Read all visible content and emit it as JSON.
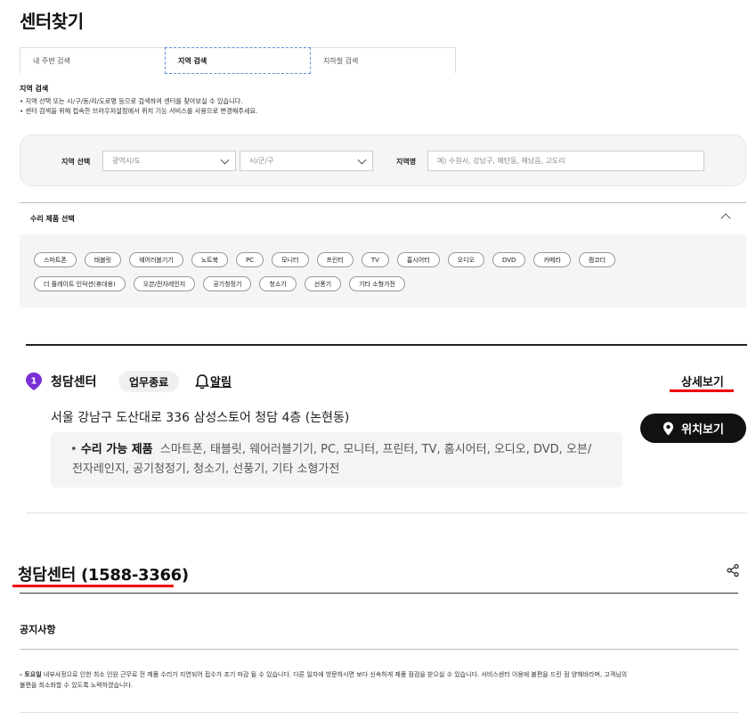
{
  "page": {
    "title": "센터찾기"
  },
  "tabs": [
    {
      "label": "내 주변 검색",
      "active": false
    },
    {
      "label": "지역 검색",
      "active": true
    },
    {
      "label": "지하철 검색",
      "active": false
    }
  ],
  "region_search": {
    "heading": "지역 검색",
    "notes": [
      "• 지역 선택 또는 시/구/동/리/도로명 등으로 검색하여 센터를 찾아보실 수 있습니다.",
      "• 센터 검색을 위해 접속한 브라우저설정에서 위치 기능 서비스를 사용으로 변경해주세요."
    ],
    "region_select_label": "지역 선택",
    "province_placeholder": "광역시/도",
    "city_placeholder": "시/군/구",
    "region_name_label": "지역명",
    "region_name_placeholder": "예) 수원시, 강남구, 매탄동, 해남읍, 고도리"
  },
  "repair": {
    "title": "수리 제품 선택",
    "chips_row1": [
      "스마트폰",
      "태블릿",
      "웨어러블기기",
      "노트북",
      "PC",
      "모니터",
      "프린터",
      "TV",
      "홈시어터",
      "오디오",
      "DVD",
      "카메라",
      "캠코더"
    ],
    "chips_row2": [
      "더 플레이트 인덕션(휴대용)",
      "오븐/전자레인지",
      "공기청정기",
      "청소기",
      "선풍기",
      "기타 소형가전"
    ]
  },
  "result": {
    "index": "1",
    "name": "청담센터",
    "status": "업무종료",
    "alarm": "알림",
    "detail": "상세보기",
    "address": "서울 강남구 도산대로 336 삼성스토어 청담 4층 (논현동)",
    "location_button": "위치보기",
    "products_label": "수리 가능 제품",
    "products_line1": "스마트폰, 태블릿, 웨어러블기기, PC, 모니터, 프린터, TV, 홈시어터, 오디오, DVD, 오븐/",
    "products_line2": "전자레인지, 공기청정기, 청소기, 선풍기, 기타 소형가전"
  },
  "detail_section": {
    "heading": "청담센터 (1588-3366)",
    "notice_title": "공지사항",
    "notice_bold": "- 토요일",
    "notice_text1": " 내부사정으로 인한 최소 인원 근무로 전 제품 수리가 지연되어 접수가 조기 마감 될 수 있습니다. 다른 일자에 방문하시면 보다 신속하게 제품 점검을 받으실 수 있습니다. 서비스센터 이용에 불편을 드린 점 양해바라며, 고객님의",
    "notice_text2": "불편을 최소화할 수 있도록 노력하겠습니다."
  },
  "colors": {
    "accent_red": "#e00000",
    "pin_purple": "#7b2fd6",
    "dark": "#111111"
  },
  "icons": [
    "pin-icon",
    "bell-icon",
    "location-icon",
    "share-icon",
    "chevron-down-icon",
    "chevron-up-icon"
  ]
}
